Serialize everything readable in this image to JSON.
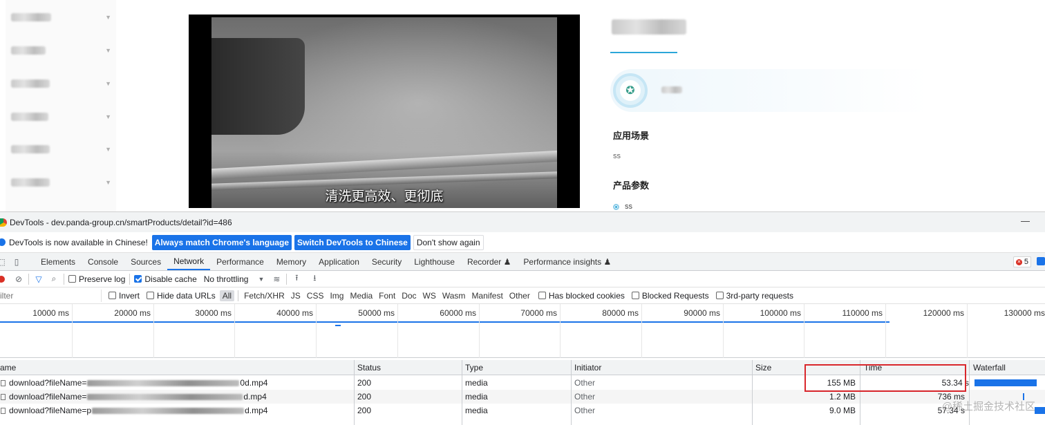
{
  "page": {
    "video_subtitle": "清洗更高效、更彻底",
    "section_scene_title": "应用场景",
    "section_scene_text": "ss",
    "section_params_title": "产品参数",
    "param_item": "ss"
  },
  "devtools": {
    "window_title": "DevTools - dev.panda-group.cn/smartProducts/detail?id=486",
    "minimize_glyph": "—",
    "infobar": {
      "message": "DevTools is now available in Chinese!",
      "btn_match": "Always match Chrome's language",
      "btn_switch": "Switch DevTools to Chinese",
      "btn_dismiss": "Don't show again"
    },
    "tabs": [
      "Elements",
      "Console",
      "Sources",
      "Network",
      "Performance",
      "Memory",
      "Application",
      "Security",
      "Lighthouse",
      "Recorder ♟",
      "Performance insights ♟"
    ],
    "error_count": "5",
    "toolbar": {
      "preserve_log": "Preserve log",
      "disable_cache": "Disable cache",
      "throttling": "No throttling"
    },
    "filter": {
      "placeholder": "ilter",
      "invert": "Invert",
      "hide_data_urls": "Hide data URLs",
      "types": [
        "All",
        "Fetch/XHR",
        "JS",
        "CSS",
        "Img",
        "Media",
        "Font",
        "Doc",
        "WS",
        "Wasm",
        "Manifest",
        "Other"
      ],
      "blocked_cookies": "Has blocked cookies",
      "blocked_requests": "Blocked Requests",
      "third_party": "3rd-party requests"
    },
    "timeline_ticks": [
      "10000 ms",
      "20000 ms",
      "30000 ms",
      "40000 ms",
      "50000 ms",
      "60000 ms",
      "70000 ms",
      "80000 ms",
      "90000 ms",
      "100000 ms",
      "110000 ms",
      "120000 ms",
      "130000 ms"
    ],
    "columns": {
      "name": "ame",
      "status": "Status",
      "type": "Type",
      "initiator": "Initiator",
      "size": "Size",
      "time": "Time",
      "waterfall": "Waterfall"
    },
    "rows": [
      {
        "name_prefix": "download?fileName=",
        "name_suffix": "0d.mp4",
        "status": "200",
        "type": "media",
        "initiator": "Other",
        "size": "155 MB",
        "time": "53.34 s"
      },
      {
        "name_prefix": "download?fileName=",
        "name_suffix": "d.mp4",
        "status": "200",
        "type": "media",
        "initiator": "Other",
        "size": "1.2 MB",
        "time": "736 ms"
      },
      {
        "name_prefix": "download?fileName=p",
        "name_suffix": "d.mp4",
        "status": "200",
        "type": "media",
        "initiator": "Other",
        "size": "9.0 MB",
        "time": "57.34 s"
      }
    ],
    "watermark": "@稀土掘金技术社区"
  }
}
